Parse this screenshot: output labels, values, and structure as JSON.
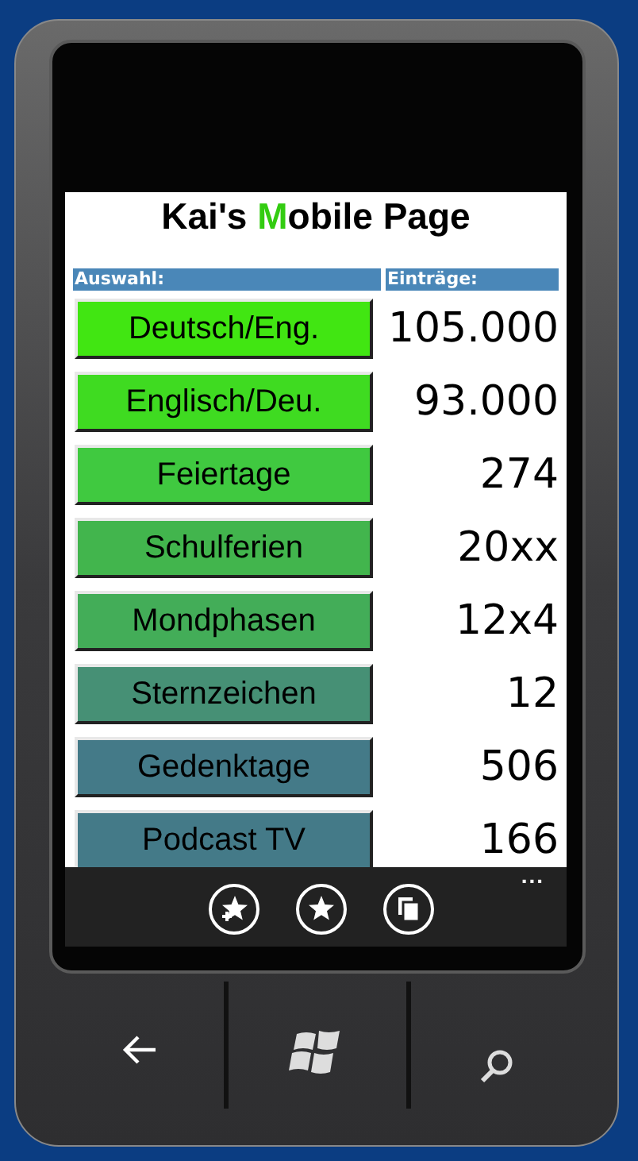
{
  "title": {
    "before": "Kai's ",
    "highlight": "M",
    "after": "obile Page"
  },
  "table": {
    "columns": [
      "Auswahl:",
      "Einträge:"
    ],
    "rows": [
      {
        "label": "Deutsch/Eng.",
        "value": "105.000",
        "color": "#41e612"
      },
      {
        "label": "Englisch/Deu.",
        "value": "93.000",
        "color": "#3fdb21"
      },
      {
        "label": "Feiertage",
        "value": "274",
        "color": "#40c940"
      },
      {
        "label": "Schulferien",
        "value": "20xx",
        "color": "#42b54d"
      },
      {
        "label": "Mondphasen",
        "value": "12x4",
        "color": "#43ad58"
      },
      {
        "label": "Sternzeichen",
        "value": "12",
        "color": "#469075"
      },
      {
        "label": "Gedenktage",
        "value": "506",
        "color": "#447a88"
      },
      {
        "label": "Podcast TV",
        "value": "166",
        "color": "#447a88"
      }
    ]
  },
  "app_bar": {
    "more": "..."
  }
}
